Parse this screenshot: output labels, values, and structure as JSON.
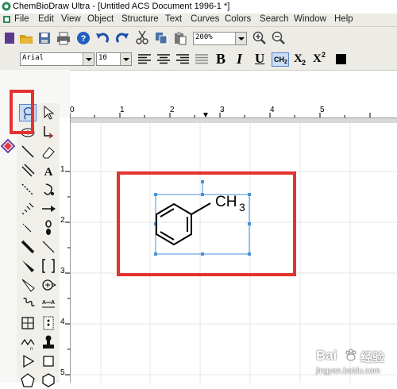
{
  "window": {
    "title": "ChemBioDraw Ultra - [Untitled ACS Document 1996-1 *]"
  },
  "menu": [
    "File",
    "Edit",
    "View",
    "Object",
    "Structure",
    "Text",
    "Curves",
    "Colors",
    "Search",
    "Window",
    "Help"
  ],
  "toolbar": {
    "zoom_value": "200%",
    "font_value": "Arial",
    "size_value": "10",
    "bold_label": "B",
    "italic_label": "I",
    "underline_label": "U",
    "ch2_label": "CH",
    "subscript_label": "X",
    "superscript_label": "X",
    "sub_digit": "2",
    "sup_digit": "2"
  },
  "ruler": {
    "h_ticks": [
      "0",
      "1",
      "2",
      "3",
      "4",
      "5"
    ],
    "v_ticks": [
      "1",
      "2",
      "3",
      "4",
      "5"
    ]
  },
  "molecule": {
    "label": "CH",
    "label_sub": "3"
  },
  "watermark": {
    "brand": "Bai",
    "brand2": "经验",
    "url": "jingyan.baidu.com"
  },
  "colors": {
    "highlight": "#e5322f",
    "selection": "#4a90d9"
  }
}
